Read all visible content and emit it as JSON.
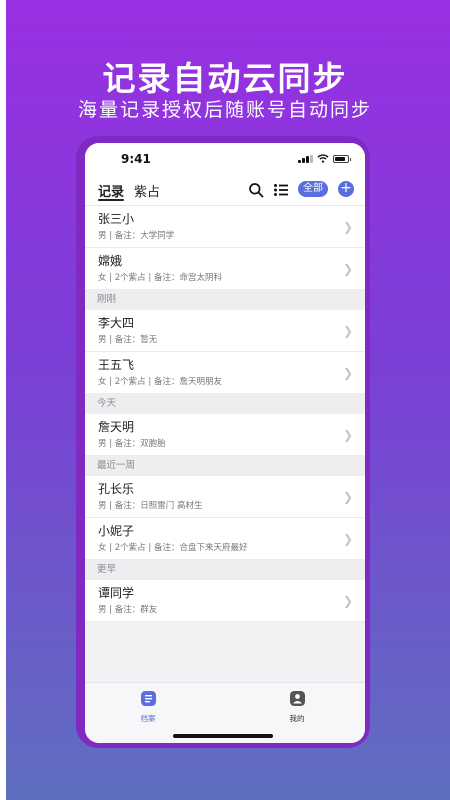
{
  "promo": {
    "headline": "记录自动云同步",
    "subline": "海量记录授权后随账号自动同步"
  },
  "status_bar": {
    "time": "9:41"
  },
  "nav": {
    "tabs": [
      {
        "label": "记录",
        "active": true
      },
      {
        "label": "紫占",
        "active": false
      }
    ],
    "filter_label": "全部",
    "add_label": "+"
  },
  "records": {
    "top": [
      {
        "name": "张三小",
        "meta": "男 | 备注：大学同学"
      },
      {
        "name": "嫦娥",
        "meta": "女 | 2个紫占 | 备注：命宫太阴科"
      }
    ],
    "section_1": "刚刚",
    "group_1": [
      {
        "name": "李大四",
        "meta": "男 | 备注：暂无"
      },
      {
        "name": "王五飞",
        "meta": "女 | 2个紫占 | 备注：詹天明朋友"
      }
    ],
    "section_2": "今天",
    "group_2": [
      {
        "name": "詹天明",
        "meta": "男 | 备注：双胞胎"
      }
    ],
    "section_3": "最近一周",
    "group_3": [
      {
        "name": "孔长乐",
        "meta": "男 | 备注：日照雷门 高材生"
      },
      {
        "name": "小妮子",
        "meta": "女 | 2个紫占 | 备注：合盘下来天府最好"
      }
    ],
    "section_4": "更早",
    "group_4": [
      {
        "name": "谭同学",
        "meta": "男 | 备注：群友"
      }
    ]
  },
  "tabbar": {
    "items": [
      {
        "label": "档案",
        "active": true
      },
      {
        "label": "我的",
        "active": false
      }
    ]
  },
  "icons": {
    "search": "search-icon",
    "list": "list-icon",
    "archive": "archive-icon",
    "profile": "profile-icon",
    "chevron": "chevron-right-icon"
  },
  "colors": {
    "accent": "#5b6ee0",
    "gradient_top": "#9a2fe3",
    "gradient_bottom": "#5f6fc0",
    "device_frame": "#7f2bc3"
  }
}
